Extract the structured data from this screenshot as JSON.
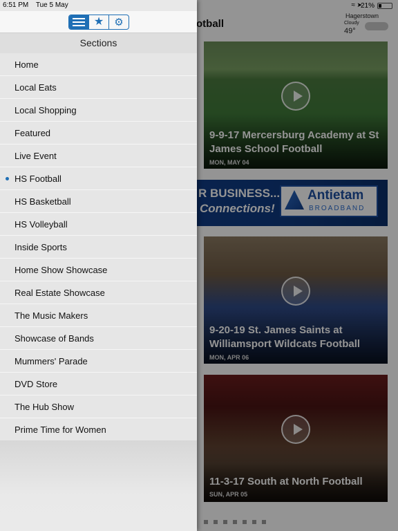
{
  "status_bar": {
    "time": "6:51 PM",
    "date": "Tue 5 May",
    "battery_percent": "21%",
    "battery_level": 0.21
  },
  "header": {
    "page_title": "otball"
  },
  "weather": {
    "city": "Hagerstown",
    "condition": "Cloudy",
    "temperature": "49°"
  },
  "drawer": {
    "segments": [
      {
        "icon": "list-icon",
        "active": true
      },
      {
        "icon": "star-icon",
        "active": false
      },
      {
        "icon": "gear-icon",
        "active": false
      }
    ],
    "sections_title": "Sections",
    "selected_index": 5,
    "items": [
      {
        "label": "Home"
      },
      {
        "label": "Local Eats"
      },
      {
        "label": "Local Shopping"
      },
      {
        "label": "Featured"
      },
      {
        "label": "Live Event"
      },
      {
        "label": "HS Football"
      },
      {
        "label": "HS Basketball"
      },
      {
        "label": "HS Volleyball"
      },
      {
        "label": "Inside Sports"
      },
      {
        "label": "Home Show Showcase"
      },
      {
        "label": "Real Estate Showcase"
      },
      {
        "label": "The Music Makers"
      },
      {
        "label": "Showcase of Bands"
      },
      {
        "label": "Mummers' Parade"
      },
      {
        "label": "DVD Store"
      },
      {
        "label": "The Hub Show"
      },
      {
        "label": "Prime Time for Women"
      }
    ]
  },
  "feed": {
    "videos": [
      {
        "title": "9-9-17 Mercersburg Academy at St James School Football",
        "date": "MON, MAY 04"
      },
      {
        "title": "9-20-19 St. James Saints at Williamsport Wildcats Football",
        "date": "MON, APR 06"
      },
      {
        "title": "11-3-17 South at North Football",
        "date": "SUN, APR 05"
      }
    ],
    "ad": {
      "headline": "R BUSINESS...",
      "subline": "Connections!",
      "brand": "Antietam",
      "brand_sub": "BROADBAND"
    }
  },
  "colors": {
    "accent": "#1f6fb5",
    "drawer_bg": "#e8e8e8",
    "overlay": "rgba(0,0,0,0.42)"
  }
}
